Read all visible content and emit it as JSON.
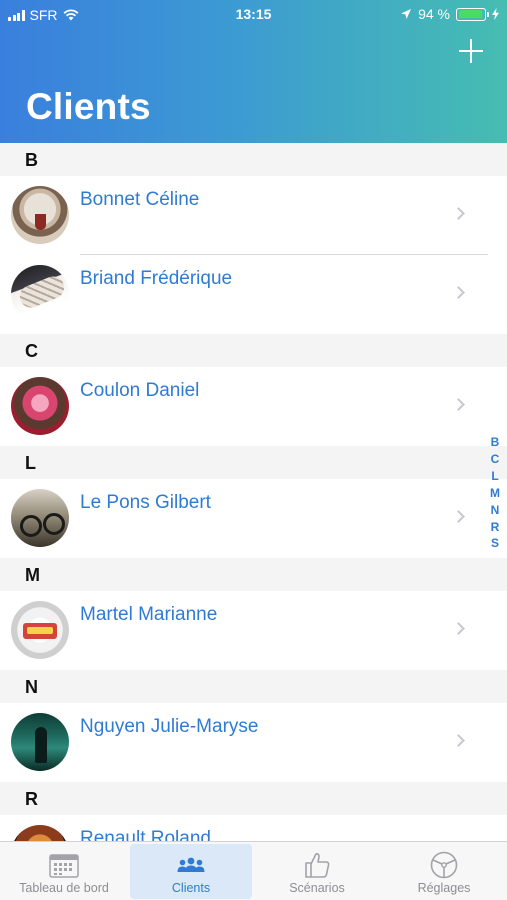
{
  "status_bar": {
    "carrier": "SFR",
    "time": "13:15",
    "battery_percent": "94 %",
    "battery_level": 0.94
  },
  "header": {
    "title": "Clients",
    "add_icon": "plus-icon",
    "gradient": [
      "#3a7fdd",
      "#46bdb2"
    ]
  },
  "sections": [
    {
      "letter": "B",
      "clients": [
        {
          "name": "Bonnet Céline"
        },
        {
          "name": "Briand Frédérique"
        }
      ]
    },
    {
      "letter": "C",
      "clients": [
        {
          "name": "Coulon Daniel"
        }
      ]
    },
    {
      "letter": "L",
      "clients": [
        {
          "name": "Le Pons Gilbert"
        }
      ]
    },
    {
      "letter": "M",
      "clients": [
        {
          "name": "Martel Marianne"
        }
      ]
    },
    {
      "letter": "N",
      "clients": [
        {
          "name": "Nguyen Julie-Maryse"
        }
      ]
    },
    {
      "letter": "R",
      "clients": [
        {
          "name": "Renault Roland"
        }
      ]
    }
  ],
  "index_letters": [
    "B",
    "C",
    "L",
    "M",
    "N",
    "R",
    "S"
  ],
  "tabs": [
    {
      "label": "Tableau de bord",
      "icon": "calendar-icon",
      "active": false
    },
    {
      "label": "Clients",
      "icon": "people-icon",
      "active": true
    },
    {
      "label": "Scénarios",
      "icon": "thumbs-up-icon",
      "active": false
    },
    {
      "label": "Réglages",
      "icon": "steering-wheel-icon",
      "active": false
    }
  ],
  "colors": {
    "accent": "#2f7bd4",
    "section_bg": "#f4f4f5",
    "battery_green": "#4cd964"
  }
}
